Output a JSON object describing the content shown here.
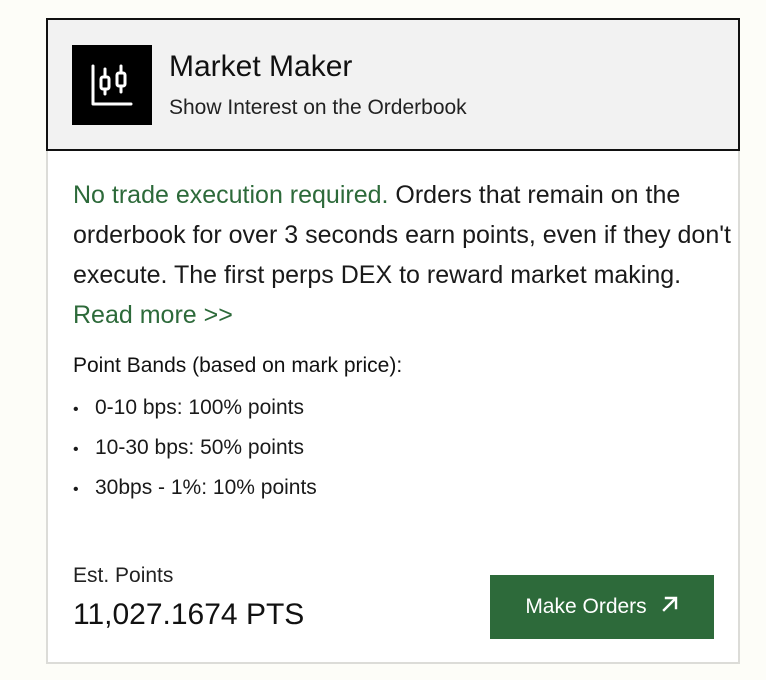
{
  "header": {
    "title": "Market Maker",
    "subtitle": "Show Interest on the Orderbook",
    "icon": "candlestick-chart-icon"
  },
  "description": {
    "highlight": "No trade execution required.",
    "body": " Orders that remain on the orderbook for over 3 seconds earn points, even if they don't execute. The first perps DEX to reward market making. ",
    "link": "Read more >>"
  },
  "bands": {
    "title": "Point Bands (based on mark price):",
    "items": [
      {
        "label": "0-10 bps: 100% points"
      },
      {
        "label": "10-30 bps: 50% points"
      },
      {
        "label": "30bps - 1%: 10% points"
      }
    ]
  },
  "points": {
    "label": "Est. Points",
    "value": "11,027.1674 PTS"
  },
  "action": {
    "label": "Make Orders",
    "icon": "arrow-up-right-icon"
  },
  "colors": {
    "accent": "#2d6a3a",
    "header_bg": "#f2f2f2",
    "logo_bg": "#000000"
  }
}
